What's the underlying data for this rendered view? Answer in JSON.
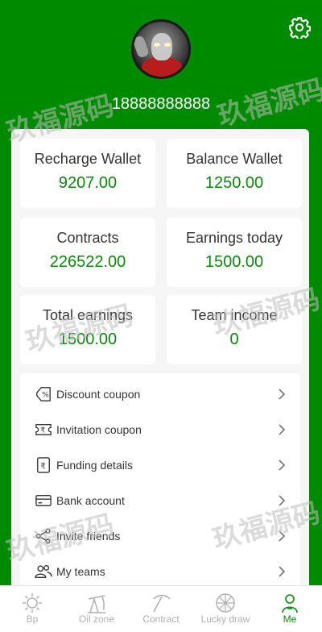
{
  "profile": {
    "phone": "18888888888"
  },
  "stats": [
    {
      "label": "Recharge Wallet",
      "value": "9207.00"
    },
    {
      "label": "Balance Wallet",
      "value": "1250.00"
    },
    {
      "label": "Contracts",
      "value": "226522.00"
    },
    {
      "label": "Earnings today",
      "value": "1500.00"
    },
    {
      "label": "Total earnings",
      "value": "1500.00"
    },
    {
      "label": "Team income",
      "value": "0"
    }
  ],
  "menu": [
    {
      "label": "Discount coupon",
      "icon": "coupon-percent-icon"
    },
    {
      "label": "Invitation coupon",
      "icon": "ticket-rupee-icon"
    },
    {
      "label": "Funding details",
      "icon": "receipt-rupee-icon"
    },
    {
      "label": "Bank account",
      "icon": "bank-card-icon"
    },
    {
      "label": "Invite friends",
      "icon": "share-icon"
    },
    {
      "label": "My teams",
      "icon": "team-icon"
    }
  ],
  "tabs": [
    {
      "label": "Bp",
      "icon": "sun-icon"
    },
    {
      "label": "Oil zone",
      "icon": "oil-pump-icon"
    },
    {
      "label": "Contract",
      "icon": "pickaxe-icon"
    },
    {
      "label": "Lucky draw",
      "icon": "wheel-icon"
    },
    {
      "label": "Me",
      "icon": "user-icon"
    }
  ],
  "watermark": "玖福源码",
  "colors": {
    "brand": "#008a00",
    "value_green": "#0a8a0a",
    "tab_inactive": "#b0b0b0"
  }
}
